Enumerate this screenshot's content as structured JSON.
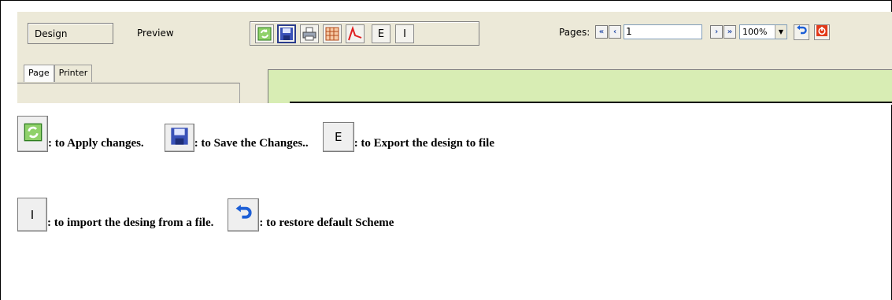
{
  "screenshot": {
    "mode_tabs": {
      "design": "Design",
      "preview": "Preview"
    },
    "toolbar": {
      "apply_icon": "refresh-icon",
      "save_icon": "floppy-disk-icon",
      "print_icon": "printer-icon",
      "grid_icon": "table-grid-icon",
      "pdf_icon": "pdf-icon",
      "export_label": "E",
      "import_label": "I"
    },
    "pages": {
      "label": "Pages:",
      "current": "1",
      "zoom": "100%"
    },
    "sub_tabs": {
      "page": "Page",
      "printer": "Printer"
    },
    "canvas_color": "#d8edb4"
  },
  "legend": {
    "apply": {
      "icon": "refresh-icon",
      "text": ": to Apply changes."
    },
    "save": {
      "icon": "floppy-disk-icon",
      "text": ": to Save the Changes.."
    },
    "export": {
      "label": "E",
      "text": ": to Export the design to file"
    },
    "import": {
      "label": "I",
      "text": ": to import the desing from a file."
    },
    "restore": {
      "icon": "undo-icon",
      "text": ": to restore default Scheme"
    }
  }
}
